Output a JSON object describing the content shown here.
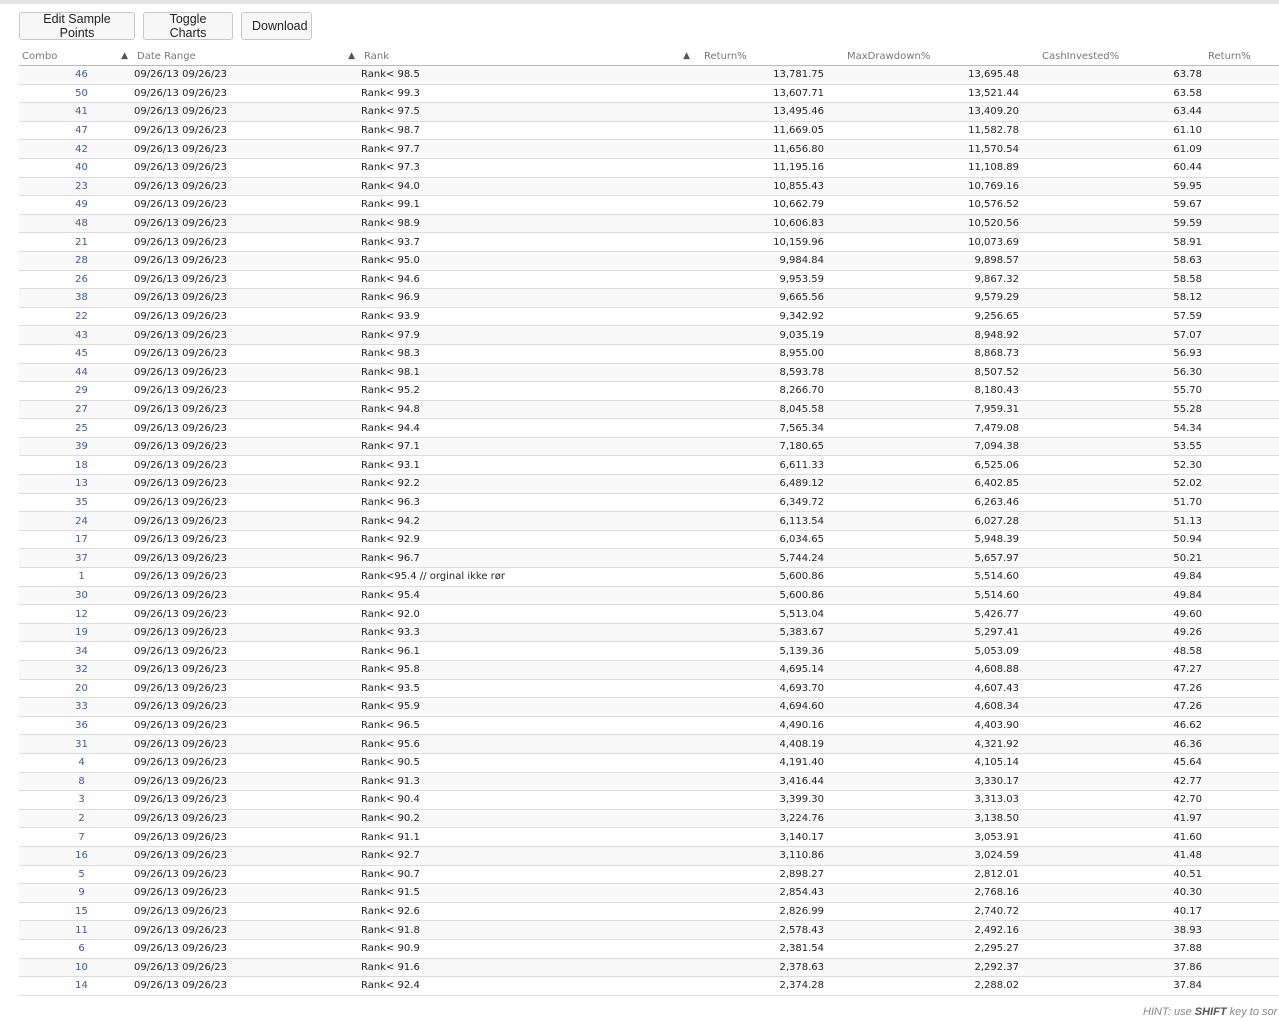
{
  "toolbar": {
    "edit_label": "Edit Sample Points",
    "toggle_label": "Toggle Charts",
    "download_label": "Download"
  },
  "table": {
    "headers": [
      "Combo",
      "Date Range",
      "Rank",
      "Return%",
      "MaxDrawdown%",
      "CashInvested%",
      "Return%"
    ],
    "rows": [
      [
        "46",
        "09/26/13 09/26/23",
        "Rank< 98.5",
        "13,781.75",
        "13,695.48",
        "63.78"
      ],
      [
        "50",
        "09/26/13 09/26/23",
        "Rank< 99.3",
        "13,607.71",
        "13,521.44",
        "63.58"
      ],
      [
        "41",
        "09/26/13 09/26/23",
        "Rank< 97.5",
        "13,495.46",
        "13,409.20",
        "63.44"
      ],
      [
        "47",
        "09/26/13 09/26/23",
        "Rank< 98.7",
        "11,669.05",
        "11,582.78",
        "61.10"
      ],
      [
        "42",
        "09/26/13 09/26/23",
        "Rank< 97.7",
        "11,656.80",
        "11,570.54",
        "61.09"
      ],
      [
        "40",
        "09/26/13 09/26/23",
        "Rank< 97.3",
        "11,195.16",
        "11,108.89",
        "60.44"
      ],
      [
        "23",
        "09/26/13 09/26/23",
        "Rank< 94.0",
        "10,855.43",
        "10,769.16",
        "59.95"
      ],
      [
        "49",
        "09/26/13 09/26/23",
        "Rank< 99.1",
        "10,662.79",
        "10,576.52",
        "59.67"
      ],
      [
        "48",
        "09/26/13 09/26/23",
        "Rank< 98.9",
        "10,606.83",
        "10,520.56",
        "59.59"
      ],
      [
        "21",
        "09/26/13 09/26/23",
        "Rank< 93.7",
        "10,159.96",
        "10,073.69",
        "58.91"
      ],
      [
        "28",
        "09/26/13 09/26/23",
        "Rank< 95.0",
        "9,984.84",
        "9,898.57",
        "58.63"
      ],
      [
        "26",
        "09/26/13 09/26/23",
        "Rank< 94.6",
        "9,953.59",
        "9,867.32",
        "58.58"
      ],
      [
        "38",
        "09/26/13 09/26/23",
        "Rank< 96.9",
        "9,665.56",
        "9,579.29",
        "58.12"
      ],
      [
        "22",
        "09/26/13 09/26/23",
        "Rank< 93.9",
        "9,342.92",
        "9,256.65",
        "57.59"
      ],
      [
        "43",
        "09/26/13 09/26/23",
        "Rank< 97.9",
        "9,035.19",
        "8,948.92",
        "57.07"
      ],
      [
        "45",
        "09/26/13 09/26/23",
        "Rank< 98.3",
        "8,955.00",
        "8,868.73",
        "56.93"
      ],
      [
        "44",
        "09/26/13 09/26/23",
        "Rank< 98.1",
        "8,593.78",
        "8,507.52",
        "56.30"
      ],
      [
        "29",
        "09/26/13 09/26/23",
        "Rank< 95.2",
        "8,266.70",
        "8,180.43",
        "55.70"
      ],
      [
        "27",
        "09/26/13 09/26/23",
        "Rank< 94.8",
        "8,045.58",
        "7,959.31",
        "55.28"
      ],
      [
        "25",
        "09/26/13 09/26/23",
        "Rank< 94.4",
        "7,565.34",
        "7,479.08",
        "54.34"
      ],
      [
        "39",
        "09/26/13 09/26/23",
        "Rank< 97.1",
        "7,180.65",
        "7,094.38",
        "53.55"
      ],
      [
        "18",
        "09/26/13 09/26/23",
        "Rank< 93.1",
        "6,611.33",
        "6,525.06",
        "52.30"
      ],
      [
        "13",
        "09/26/13 09/26/23",
        "Rank< 92.2",
        "6,489.12",
        "6,402.85",
        "52.02"
      ],
      [
        "35",
        "09/26/13 09/26/23",
        "Rank< 96.3",
        "6,349.72",
        "6,263.46",
        "51.70"
      ],
      [
        "24",
        "09/26/13 09/26/23",
        "Rank< 94.2",
        "6,113.54",
        "6,027.28",
        "51.13"
      ],
      [
        "17",
        "09/26/13 09/26/23",
        "Rank< 92.9",
        "6,034.65",
        "5,948.39",
        "50.94"
      ],
      [
        "37",
        "09/26/13 09/26/23",
        "Rank< 96.7",
        "5,744.24",
        "5,657.97",
        "50.21"
      ],
      [
        "1",
        "09/26/13 09/26/23",
        "Rank<95.4 // orginal ikke rør",
        "5,600.86",
        "5,514.60",
        "49.84"
      ],
      [
        "30",
        "09/26/13 09/26/23",
        "Rank< 95.4",
        "5,600.86",
        "5,514.60",
        "49.84"
      ],
      [
        "12",
        "09/26/13 09/26/23",
        "Rank< 92.0",
        "5,513.04",
        "5,426.77",
        "49.60"
      ],
      [
        "19",
        "09/26/13 09/26/23",
        "Rank< 93.3",
        "5,383.67",
        "5,297.41",
        "49.26"
      ],
      [
        "34",
        "09/26/13 09/26/23",
        "Rank< 96.1",
        "5,139.36",
        "5,053.09",
        "48.58"
      ],
      [
        "32",
        "09/26/13 09/26/23",
        "Rank< 95.8",
        "4,695.14",
        "4,608.88",
        "47.27"
      ],
      [
        "20",
        "09/26/13 09/26/23",
        "Rank< 93.5",
        "4,693.70",
        "4,607.43",
        "47.26"
      ],
      [
        "33",
        "09/26/13 09/26/23",
        "Rank< 95.9",
        "4,694.60",
        "4,608.34",
        "47.26"
      ],
      [
        "36",
        "09/26/13 09/26/23",
        "Rank< 96.5",
        "4,490.16",
        "4,403.90",
        "46.62"
      ],
      [
        "31",
        "09/26/13 09/26/23",
        "Rank< 95.6",
        "4,408.19",
        "4,321.92",
        "46.36"
      ],
      [
        "4",
        "09/26/13 09/26/23",
        "Rank< 90.5",
        "4,191.40",
        "4,105.14",
        "45.64"
      ],
      [
        "8",
        "09/26/13 09/26/23",
        "Rank< 91.3",
        "3,416.44",
        "3,330.17",
        "42.77"
      ],
      [
        "3",
        "09/26/13 09/26/23",
        "Rank< 90.4",
        "3,399.30",
        "3,313.03",
        "42.70"
      ],
      [
        "2",
        "09/26/13 09/26/23",
        "Rank< 90.2",
        "3,224.76",
        "3,138.50",
        "41.97"
      ],
      [
        "7",
        "09/26/13 09/26/23",
        "Rank< 91.1",
        "3,140.17",
        "3,053.91",
        "41.60"
      ],
      [
        "16",
        "09/26/13 09/26/23",
        "Rank< 92.7",
        "3,110.86",
        "3,024.59",
        "41.48"
      ],
      [
        "5",
        "09/26/13 09/26/23",
        "Rank< 90.7",
        "2,898.27",
        "2,812.01",
        "40.51"
      ],
      [
        "9",
        "09/26/13 09/26/23",
        "Rank< 91.5",
        "2,854.43",
        "2,768.16",
        "40.30"
      ],
      [
        "15",
        "09/26/13 09/26/23",
        "Rank< 92.6",
        "2,826.99",
        "2,740.72",
        "40.17"
      ],
      [
        "11",
        "09/26/13 09/26/23",
        "Rank< 91.8",
        "2,578.43",
        "2,492.16",
        "38.93"
      ],
      [
        "6",
        "09/26/13 09/26/23",
        "Rank< 90.9",
        "2,381.54",
        "2,295.27",
        "37.88"
      ],
      [
        "10",
        "09/26/13 09/26/23",
        "Rank< 91.6",
        "2,378.63",
        "2,292.37",
        "37.86"
      ],
      [
        "14",
        "09/26/13 09/26/23",
        "Rank< 92.4",
        "2,374.28",
        "2,288.02",
        "37.84"
      ]
    ]
  },
  "hint": {
    "prefix": "HINT: use ",
    "key": "SHIFT",
    "suffix": " key to sor"
  }
}
